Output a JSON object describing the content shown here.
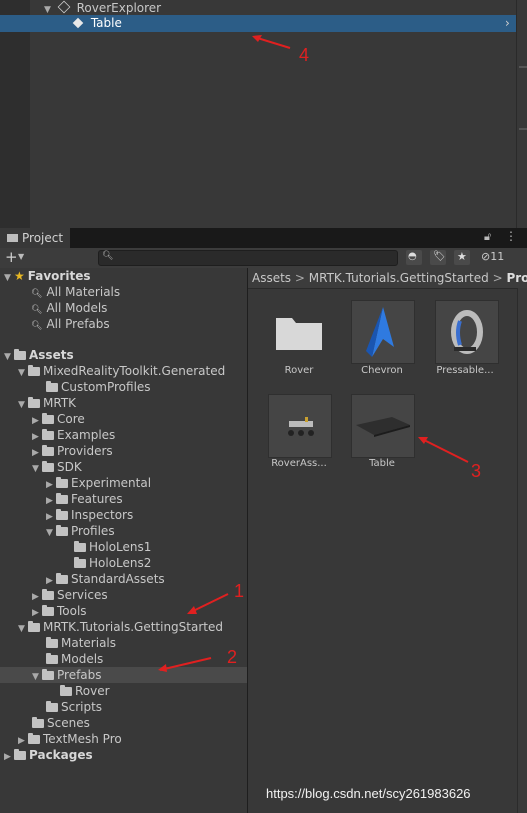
{
  "hierarchy": {
    "rows": [
      {
        "label": "RoverExplorer"
      },
      {
        "label": "Table"
      }
    ]
  },
  "project": {
    "tab_label": "Project",
    "hidden_count": "11",
    "breadcrumb": [
      "Assets",
      "MRTK.Tutorials.GettingStarted",
      "Pro"
    ],
    "tree": [
      {
        "label": "Favorites"
      },
      {
        "label": "All Materials"
      },
      {
        "label": "All Models"
      },
      {
        "label": "All Prefabs"
      },
      {
        "label": "Assets"
      },
      {
        "label": "MixedRealityToolkit.Generated"
      },
      {
        "label": "CustomProfiles"
      },
      {
        "label": "MRTK"
      },
      {
        "label": "Core"
      },
      {
        "label": "Examples"
      },
      {
        "label": "Providers"
      },
      {
        "label": "SDK"
      },
      {
        "label": "Experimental"
      },
      {
        "label": "Features"
      },
      {
        "label": "Inspectors"
      },
      {
        "label": "Profiles"
      },
      {
        "label": "HoloLens1"
      },
      {
        "label": "HoloLens2"
      },
      {
        "label": "StandardAssets"
      },
      {
        "label": "Services"
      },
      {
        "label": "Tools"
      },
      {
        "label": "MRTK.Tutorials.GettingStarted"
      },
      {
        "label": "Materials"
      },
      {
        "label": "Models"
      },
      {
        "label": "Prefabs"
      },
      {
        "label": "Rover"
      },
      {
        "label": "Scripts"
      },
      {
        "label": "Scenes"
      },
      {
        "label": "TextMesh Pro"
      },
      {
        "label": "Packages"
      }
    ],
    "assets": [
      {
        "label": "Rover"
      },
      {
        "label": "Chevron"
      },
      {
        "label": "Pressable..."
      },
      {
        "label": "RoverAss..."
      },
      {
        "label": "Table"
      }
    ]
  },
  "annotations": [
    "1",
    "2",
    "3",
    "4"
  ],
  "watermark": "https://blog.csdn.net/scy261983626"
}
